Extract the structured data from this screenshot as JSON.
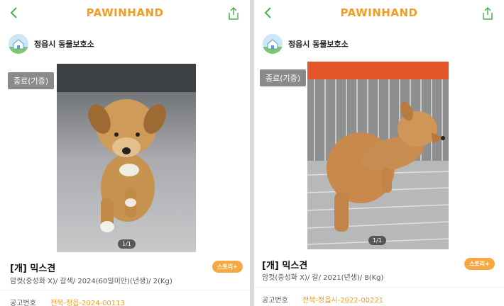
{
  "left": {
    "brand": "PAWINHAND",
    "shelter_name": "정읍시 동물보호소",
    "status_badge": "종료(기증)",
    "image_counter": "1/1",
    "title": "[개] 믹스견",
    "story_button": "스토리+",
    "details": "암컷(중성화 X)/ 갈색/ 2024(60일미만)(년생)/ 2(Kg)",
    "notice_label": "공고번호",
    "notice_value": "전북-정읍-2024-00113"
  },
  "right": {
    "brand": "PAWINHAND",
    "shelter_name": "정읍시 동물보호소",
    "status_badge": "종료(기증)",
    "image_counter": "1/1",
    "title": "[개] 믹스견",
    "story_button": "스토리+",
    "details": "암컷(중성화 X)/ 갈/ 2021(년생)/ 8(Kg)",
    "notice_label": "공고번호",
    "notice_value": "전북-정읍시-2022-00221"
  },
  "colors": {
    "brand": "#f39c1f",
    "status_bg": "#8a8a8a",
    "story_bg": "#f6a942"
  },
  "icons": {
    "back": "chevron-left-icon",
    "share": "share-icon",
    "shelter": "house-icon"
  }
}
